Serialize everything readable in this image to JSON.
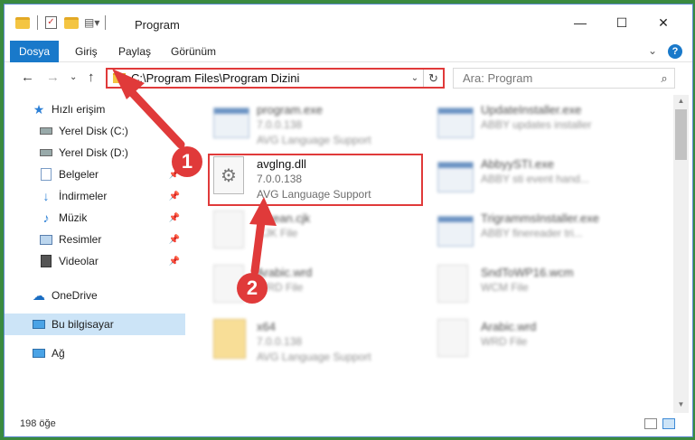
{
  "window": {
    "title": "Program",
    "minimize": "—",
    "maximize": "☐",
    "close": "✕"
  },
  "ribbon": {
    "tabs": [
      "Dosya",
      "Giriş",
      "Paylaş",
      "Görünüm"
    ],
    "expand": "⌄",
    "help": "?"
  },
  "nav": {
    "back": "←",
    "forward": "→",
    "recent": "⌄",
    "up": "↑",
    "address": "C:\\Program Files\\Program Dizini",
    "address_dropdown": "⌄",
    "refresh": "↻",
    "search_placeholder": "Ara: Program",
    "search_icon": "⌕"
  },
  "sidebar": {
    "items": [
      {
        "label": "Hızlı erişim",
        "icon": "star-icon"
      },
      {
        "label": "Yerel Disk (C:)",
        "icon": "drive-icon"
      },
      {
        "label": "Yerel Disk (D:)",
        "icon": "drive-icon"
      },
      {
        "label": "Belgeler",
        "icon": "documents-icon"
      },
      {
        "label": "İndirmeler",
        "icon": "download-icon"
      },
      {
        "label": "Müzik",
        "icon": "music-icon"
      },
      {
        "label": "Resimler",
        "icon": "pictures-icon"
      },
      {
        "label": "Videolar",
        "icon": "videos-icon"
      },
      {
        "label": "OneDrive",
        "icon": "cloud-icon"
      },
      {
        "label": "Bu bilgisayar",
        "icon": "computer-icon"
      },
      {
        "label": "Ağ",
        "icon": "network-icon"
      }
    ]
  },
  "files": [
    {
      "name": "program.exe",
      "line2": "7.0.0.138",
      "line3": "AVG Language Support"
    },
    {
      "name": "UpdateInstaller.exe",
      "line2": "ABBY updates installer",
      "line3": ""
    },
    {
      "name": "avglng.dll",
      "line2": "7.0.0.138",
      "line3": "AVG Language Support"
    },
    {
      "name": "AbbyySTI.exe",
      "line2": "ABBY sti event hand...",
      "line3": ""
    },
    {
      "name": "korean.cjk",
      "line2": "CJK File",
      "line3": ""
    },
    {
      "name": "TrigrammsInstaller.exe",
      "line2": "ABBY finereader tri...",
      "line3": ""
    },
    {
      "name": "Arabic.wrd",
      "line2": "WRD File",
      "line3": ""
    },
    {
      "name": "SndToWP16.wcm",
      "line2": "WCM File",
      "line3": ""
    },
    {
      "name": "x64",
      "line2": "7.0.0.138",
      "line3": "AVG Language Support"
    },
    {
      "name": "Arabic.wrd",
      "line2": "WRD File",
      "line3": ""
    }
  ],
  "status": {
    "count": "198 öğe"
  },
  "annotations": {
    "step1": "1",
    "step2": "2",
    "color": "#e03a3a"
  }
}
